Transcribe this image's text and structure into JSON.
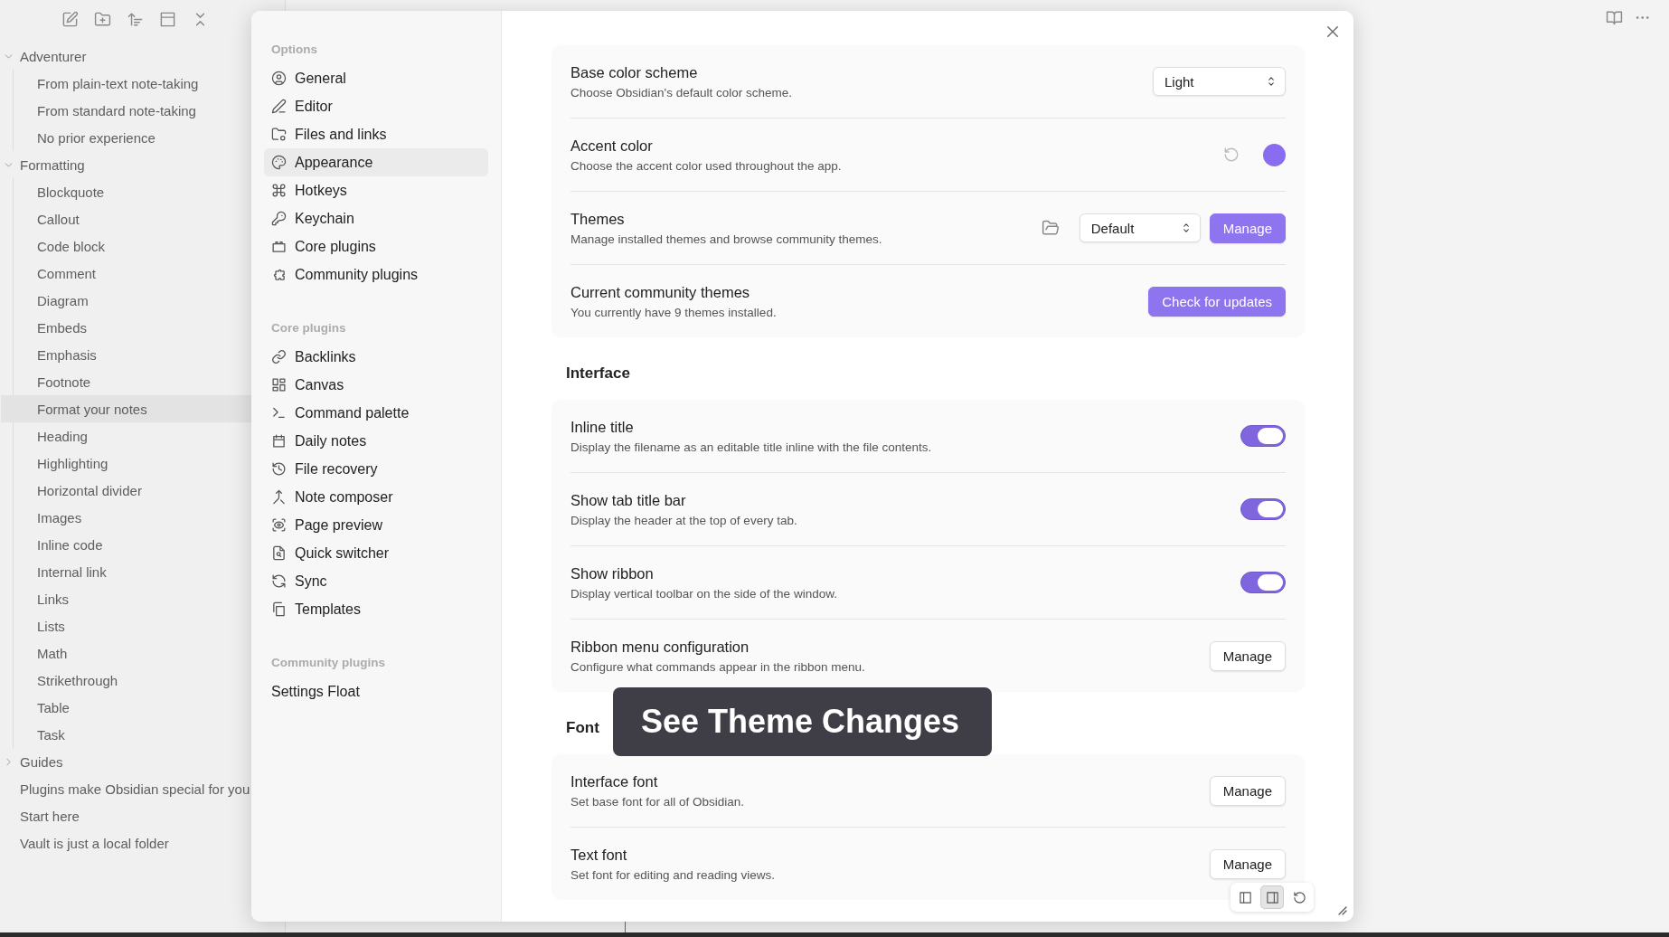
{
  "explorer": {
    "tree": [
      {
        "label": "Adventurer",
        "expanded": true,
        "selected": false,
        "children": [
          {
            "label": "From plain-text note-taking",
            "selected": false
          },
          {
            "label": "From standard note-taking",
            "selected": false
          },
          {
            "label": "No prior experience",
            "selected": false
          }
        ]
      },
      {
        "label": "Formatting",
        "expanded": true,
        "selected": false,
        "children": [
          {
            "label": "Blockquote",
            "selected": false
          },
          {
            "label": "Callout",
            "selected": false
          },
          {
            "label": "Code block",
            "selected": false
          },
          {
            "label": "Comment",
            "selected": false
          },
          {
            "label": "Diagram",
            "selected": false
          },
          {
            "label": "Embeds",
            "selected": false
          },
          {
            "label": "Emphasis",
            "selected": false
          },
          {
            "label": "Footnote",
            "selected": false
          },
          {
            "label": "Format your notes",
            "selected": true
          },
          {
            "label": "Heading",
            "selected": false
          },
          {
            "label": "Highlighting",
            "selected": false
          },
          {
            "label": "Horizontal divider",
            "selected": false
          },
          {
            "label": "Images",
            "selected": false
          },
          {
            "label": "Inline code",
            "selected": false
          },
          {
            "label": "Internal link",
            "selected": false
          },
          {
            "label": "Links",
            "selected": false
          },
          {
            "label": "Lists",
            "selected": false
          },
          {
            "label": "Math",
            "selected": false
          },
          {
            "label": "Strikethrough",
            "selected": false
          },
          {
            "label": "Table",
            "selected": false
          },
          {
            "label": "Task",
            "selected": false
          }
        ]
      },
      {
        "label": "Guides",
        "expanded": false,
        "selected": false
      },
      {
        "label": "Plugins make Obsidian special for you",
        "selected": false
      },
      {
        "label": "Start here",
        "selected": false
      },
      {
        "label": "Vault is just a local folder",
        "selected": false
      }
    ]
  },
  "settings": {
    "nav": [
      {
        "heading": "Options",
        "items": [
          {
            "label": "General",
            "selected": false
          },
          {
            "label": "Editor",
            "selected": false
          },
          {
            "label": "Files and links",
            "selected": false
          },
          {
            "label": "Appearance",
            "selected": true
          },
          {
            "label": "Hotkeys",
            "selected": false
          },
          {
            "label": "Keychain",
            "selected": false
          },
          {
            "label": "Core plugins",
            "selected": false
          },
          {
            "label": "Community plugins",
            "selected": false
          }
        ]
      },
      {
        "heading": "Core plugins",
        "items": [
          {
            "label": "Backlinks",
            "selected": false
          },
          {
            "label": "Canvas",
            "selected": false
          },
          {
            "label": "Command palette",
            "selected": false
          },
          {
            "label": "Daily notes",
            "selected": false
          },
          {
            "label": "File recovery",
            "selected": false
          },
          {
            "label": "Note composer",
            "selected": false
          },
          {
            "label": "Page preview",
            "selected": false
          },
          {
            "label": "Quick switcher",
            "selected": false
          },
          {
            "label": "Sync",
            "selected": false
          },
          {
            "label": "Templates",
            "selected": false
          }
        ]
      },
      {
        "heading": "Community plugins",
        "items": [
          {
            "label": "Settings Float",
            "selected": false
          }
        ]
      }
    ],
    "sections": [
      {
        "rows": [
          {
            "kind": "select",
            "title": "Base color scheme",
            "description": "Choose Obsidian's default color scheme.",
            "value": "Light"
          },
          {
            "kind": "accent",
            "title": "Accent color",
            "description": "Choose the accent color used throughout the app.",
            "color": "#8a6cf0"
          },
          {
            "kind": "themes",
            "title": "Themes",
            "description": "Manage installed themes and browse community themes.",
            "value": "Default",
            "button": "Manage"
          },
          {
            "kind": "button",
            "title": "Current community themes",
            "description": "You currently have 9 themes installed.",
            "button": "Check for updates",
            "primary": true
          }
        ]
      },
      {
        "heading": "Interface",
        "rows": [
          {
            "kind": "toggle",
            "title": "Inline title",
            "description": "Display the filename as an editable title inline with the file contents.",
            "on": true
          },
          {
            "kind": "toggle",
            "title": "Show tab title bar",
            "description": "Display the header at the top of every tab.",
            "on": true
          },
          {
            "kind": "toggle",
            "title": "Show ribbon",
            "description": "Display vertical toolbar on the side of the window.",
            "on": true
          },
          {
            "kind": "button",
            "title": "Ribbon menu configuration",
            "description": "Configure what commands appear in the ribbon menu.",
            "button": "Manage",
            "primary": false
          }
        ]
      },
      {
        "heading": "Font",
        "rows": [
          {
            "kind": "button",
            "title": "Interface font",
            "description": "Set base font for all of Obsidian.",
            "button": "Manage",
            "primary": false
          },
          {
            "kind": "button",
            "title": "Text font",
            "description": "Set font for editing and reading views.",
            "button": "Manage",
            "primary": false
          }
        ]
      }
    ]
  },
  "caption": "See Theme Changes",
  "dock_buttons": [
    {
      "selected": false
    },
    {
      "selected": true
    },
    {
      "selected": false
    }
  ]
}
